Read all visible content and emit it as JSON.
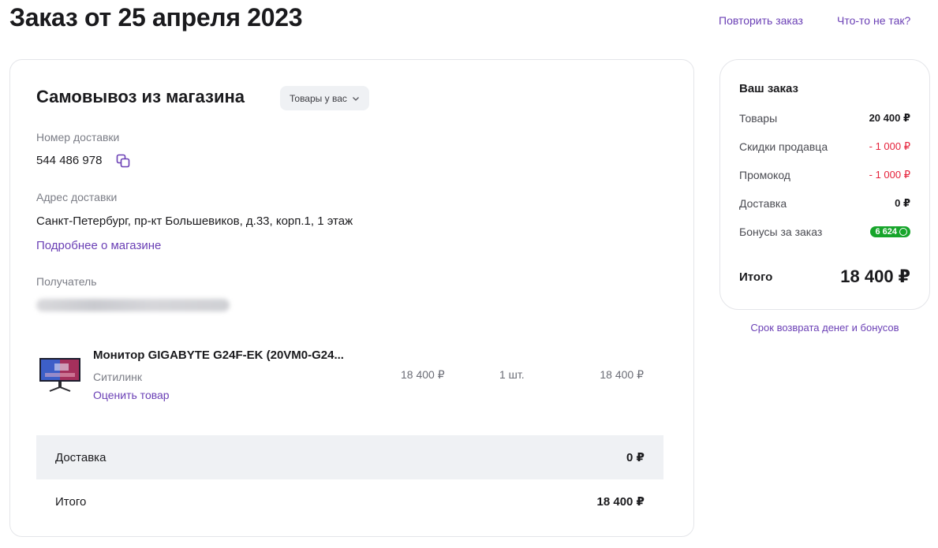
{
  "header": {
    "title": "Заказ от 25 апреля 2023",
    "repeat_order": "Повторить заказ",
    "something_wrong": "Что-то не так?"
  },
  "delivery": {
    "title": "Самовывоз из магазина",
    "chip": "Товары у вас",
    "number_label": "Номер доставки",
    "number": "544 486 978",
    "address_label": "Адрес доставки",
    "address": "Санкт-Петербург, пр-кт Большевиков, д.33, корп.1, 1 этаж",
    "store_link": "Подробнее о магазине",
    "recipient_label": "Получатель"
  },
  "product": {
    "name": "Монитор GIGABYTE G24F-EK (20VM0-G24...",
    "seller": "Ситилинк",
    "rate_link": "Оценить товар",
    "unit_price": "18 400 ₽",
    "quantity": "1 шт.",
    "total_price": "18 400 ₽"
  },
  "footer": {
    "delivery_label": "Доставка",
    "delivery_value": "0 ₽",
    "total_label": "Итого",
    "total_value": "18 400 ₽"
  },
  "summary": {
    "title": "Ваш заказ",
    "goods_label": "Товары",
    "goods_value": "20 400 ₽",
    "seller_discount_label": "Скидки продавца",
    "seller_discount_value": "- 1 000 ₽",
    "promo_label": "Промокод",
    "promo_value": "- 1 000 ₽",
    "delivery_label": "Доставка",
    "delivery_value": "0 ₽",
    "bonus_label": "Бонусы за заказ",
    "bonus_value": "6 624",
    "total_label": "Итого",
    "total_value": "18 400 ₽",
    "refund_link": "Срок возврата денег и бонусов"
  },
  "colors": {
    "accent": "#6a3fb5",
    "negative": "#e5223b",
    "bonus": "#17a52b"
  }
}
